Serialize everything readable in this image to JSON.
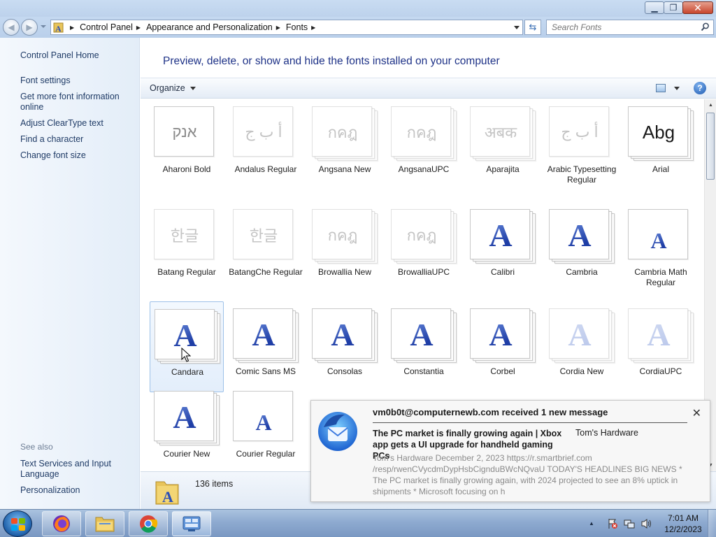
{
  "window": {
    "minimize_icon": "minimize-icon",
    "maximize_icon": "restore-icon",
    "close_icon": "close-icon"
  },
  "address": {
    "crumbs": [
      "Control Panel",
      "Appearance and Personalization",
      "Fonts"
    ],
    "search_placeholder": "Search Fonts"
  },
  "leftnav": {
    "home": "Control Panel Home",
    "links": [
      "Font settings",
      "Get more font information online",
      "Adjust ClearType text",
      "Find a character",
      "Change font size"
    ],
    "see_also": "See also",
    "see_also_links": [
      "Text Services and Input Language",
      "Personalization"
    ]
  },
  "main": {
    "heading": "Preview, delete, or show and hide the fonts installed on your computer",
    "organize": "Organize"
  },
  "fonts": [
    {
      "name": "Aharoni Bold",
      "glyph": "אנק",
      "faded": false,
      "stack": false
    },
    {
      "name": "Andalus Regular",
      "glyph": "أ ب ج",
      "faded": true,
      "stack": false
    },
    {
      "name": "Angsana New",
      "glyph": "กคฎ",
      "faded": true,
      "stack": true
    },
    {
      "name": "AngsanaUPC",
      "glyph": "กคฎ",
      "faded": true,
      "stack": true
    },
    {
      "name": "Aparajita",
      "glyph": "अबक",
      "faded": true,
      "stack": true
    },
    {
      "name": "Arabic Typesetting Regular",
      "glyph": "أ ب ج",
      "faded": true,
      "stack": false
    },
    {
      "name": "Arial",
      "glyph": "Abg",
      "faded": false,
      "stack": true
    },
    {
      "name": "Batang Regular",
      "glyph": "한글",
      "faded": true,
      "stack": false
    },
    {
      "name": "BatangChe Regular",
      "glyph": "한글",
      "faded": true,
      "stack": false
    },
    {
      "name": "Browallia New",
      "glyph": "กคฎ",
      "faded": true,
      "stack": true
    },
    {
      "name": "BrowalliaUPC",
      "glyph": "กคฎ",
      "faded": true,
      "stack": true
    },
    {
      "name": "Calibri",
      "glyph": "A",
      "faded": false,
      "stack": true
    },
    {
      "name": "Cambria",
      "glyph": "A",
      "faded": false,
      "stack": true
    },
    {
      "name": "Cambria Math Regular",
      "glyph": "A",
      "faded": false,
      "stack": false
    },
    {
      "name": "Candara",
      "glyph": "A",
      "faded": false,
      "stack": true
    },
    {
      "name": "Comic Sans MS",
      "glyph": "A",
      "faded": false,
      "stack": true
    },
    {
      "name": "Consolas",
      "glyph": "A",
      "faded": false,
      "stack": true
    },
    {
      "name": "Constantia",
      "glyph": "A",
      "faded": false,
      "stack": true
    },
    {
      "name": "Corbel",
      "glyph": "A",
      "faded": false,
      "stack": true
    },
    {
      "name": "Cordia New",
      "glyph": "A",
      "faded": true,
      "stack": true
    },
    {
      "name": "CordiaUPC",
      "glyph": "A",
      "faded": true,
      "stack": true
    },
    {
      "name": "Courier New",
      "glyph": "A",
      "faded": false,
      "stack": true
    },
    {
      "name": "Courier Regular",
      "glyph": "A",
      "faded": false,
      "stack": false
    }
  ],
  "selected_font": "Candara",
  "details": {
    "count": "136 items"
  },
  "notification": {
    "title": "vm0b0t@computernewb.com received 1 new message",
    "subject": "The PC market is finally growing again | Xbox app gets a UI upgrade for handheld gaming PCs",
    "from": "Tom's Hardware",
    "body": "Tom's Hardware December 2, 2023 https://r.smartbrief.com /resp/rwenCVycdmDypHsbCignduBWcNQvaU TODAY'S HEADLINES BIG NEWS * The PC market is finally growing again, with 2024 projected to see an 8% uptick in shipments * Microsoft focusing on h"
  },
  "taskbar": {
    "apps": [
      "firefox-icon",
      "file-explorer-icon",
      "chrome-icon",
      "control-panel-icon"
    ],
    "time": "7:01 AM",
    "date": "12/2/2023"
  }
}
